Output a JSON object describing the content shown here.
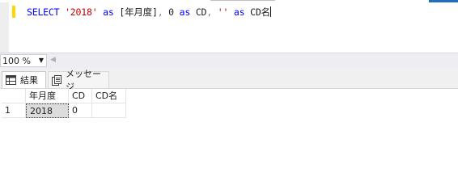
{
  "editor": {
    "tokens": [
      {
        "text": "SELECT",
        "kind": "kw"
      },
      {
        "text": " ",
        "kind": "id"
      },
      {
        "text": "'2018'",
        "kind": "str"
      },
      {
        "text": " ",
        "kind": "id"
      },
      {
        "text": "as",
        "kind": "kw"
      },
      {
        "text": " ",
        "kind": "id"
      },
      {
        "text": "[年月度]",
        "kind": "id"
      },
      {
        "text": ", ",
        "kind": "op"
      },
      {
        "text": "0",
        "kind": "id"
      },
      {
        "text": " ",
        "kind": "id"
      },
      {
        "text": "as",
        "kind": "kw"
      },
      {
        "text": " ",
        "kind": "id"
      },
      {
        "text": "CD",
        "kind": "id"
      },
      {
        "text": ", ",
        "kind": "op"
      },
      {
        "text": "''",
        "kind": "str"
      },
      {
        "text": " ",
        "kind": "id"
      },
      {
        "text": "as",
        "kind": "kw"
      },
      {
        "text": " ",
        "kind": "id"
      },
      {
        "text": "CD名",
        "kind": "id"
      }
    ]
  },
  "zoom": {
    "value": "100 %"
  },
  "tabs": [
    {
      "label": "結果",
      "icon": "grid-icon",
      "active": true
    },
    {
      "label": "メッセージ",
      "icon": "message-icon",
      "active": false
    }
  ],
  "results": {
    "columns": [
      "",
      "年月度",
      "CD",
      "CD名"
    ],
    "rows": [
      [
        "1",
        "2018",
        "0",
        ""
      ]
    ]
  },
  "colors": {
    "keyword": "#0000ff",
    "string": "#c00000",
    "change_bar": "#ffd700",
    "selected_cell": "#dcdcdc"
  }
}
